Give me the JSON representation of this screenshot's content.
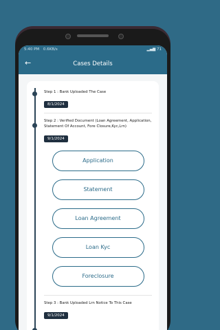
{
  "status_bar": {
    "time": "5:40 PM",
    "network_info": "0.6KB/s",
    "battery": "71"
  },
  "header": {
    "back_icon": "←",
    "title": "Cases Details"
  },
  "steps": [
    {
      "label": "Step 1 : Bank Uploaded The Case",
      "date": "8/1/2024"
    },
    {
      "label": "Step 2 : Verified Document (Loan Agreement, Application, Statement Of Account, Fore Closure,Kyc,Lrn)",
      "date": "9/1/2024"
    },
    {
      "label": "Step 3 : Bank Uploaded Lrn Notice To This Case",
      "date": "9/1/2024"
    }
  ],
  "documents": [
    "Application",
    "Statement",
    "Loan Agreement",
    "Loan Kyc",
    "Foreclosure"
  ],
  "colors": {
    "primary": "#2b6b89",
    "chip": "#1f2f3f",
    "background": "#2f6a86"
  }
}
